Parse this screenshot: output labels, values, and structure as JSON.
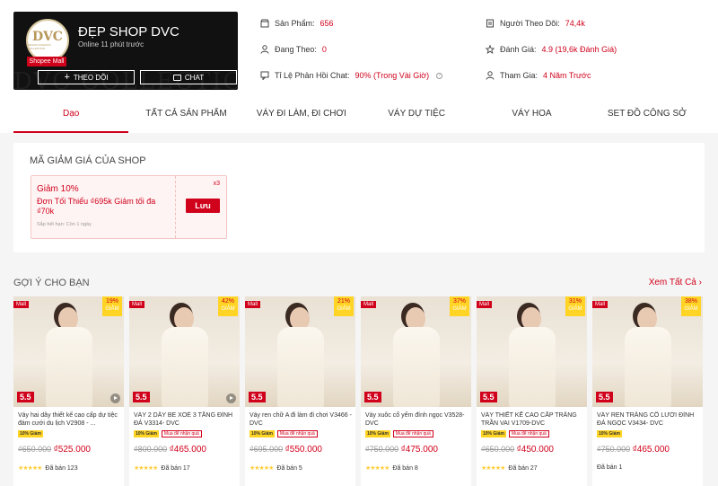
{
  "shop": {
    "name": "ĐẸP SHOP DVC",
    "online": "Online 11 phút trước",
    "mall_badge": "Shopee Mall",
    "avatar_logo": "DVC",
    "avatar_sub": "DESIGN FASHION COLLECTION",
    "bg_text": "DVC COLLECTION",
    "follow_label": "THEO DÕI",
    "chat_label": "CHAT"
  },
  "stats": {
    "products_label": "Sản Phẩm:",
    "products_value": "656",
    "following_label": "Đang Theo:",
    "following_value": "0",
    "chat_label": "Tỉ Lệ Phản Hồi Chat:",
    "chat_value": "90% (Trong Vài Giờ)",
    "followers_label": "Người Theo Dõi:",
    "followers_value": "74,4k",
    "rating_label": "Đánh Giá:",
    "rating_value": "4.9 (19,6k Đánh Giá)",
    "joined_label": "Tham Gia:",
    "joined_value": "4 Năm Trước"
  },
  "tabs": [
    {
      "label": "Dạo"
    },
    {
      "label": "TẤT CẢ SẢN PHẨM"
    },
    {
      "label": "VÁY ĐI LÀM, ĐI CHƠI"
    },
    {
      "label": "VÁY DỰ TIỆC"
    },
    {
      "label": "VÁY HOA"
    },
    {
      "label": "SET ĐỒ CÔNG SỞ"
    }
  ],
  "voucher": {
    "section_title": "MÃ GIẢM GIÁ CỦA SHOP",
    "title": "Giảm 10%",
    "desc": "Đơn Tối Thiểu ₫695k Giảm tối đa ₫70k",
    "expiry": "Sắp hết hạn: Còn 1 ngày",
    "qty": "x3",
    "button": "Lưu"
  },
  "recommend": {
    "title": "GỢI Ý CHO BẠN",
    "see_all": "Xem Tất Cả"
  },
  "common": {
    "mall": "Mall",
    "giam": "GIẢM",
    "five": "5.5",
    "tag1": "10% Giảm",
    "tag2": "Mua để nhận quà",
    "stars": "★★★★★"
  },
  "products": [
    {
      "discount": "19%",
      "name": "Váy hai dây thiết kế cao cấp dự tiệc đám cưới du lịch V2908 - ...",
      "old": "₫650.000",
      "new": "₫525.000",
      "sold": "Đã bán 123",
      "has_play": true,
      "has_tag2": false,
      "has_stars": true
    },
    {
      "discount": "42%",
      "name": "VÁY 2 DÂY BE XOÈ 3 TẦNG ĐÍNH ĐÁ V3314- DVC",
      "old": "₫800.000",
      "new": "₫465.000",
      "sold": "Đã bán 17",
      "has_play": true,
      "has_tag2": true,
      "has_stars": true
    },
    {
      "discount": "21%",
      "name": "Váy ren chữ A đi làm đi chơi V3466 - DVC",
      "old": "₫695.000",
      "new": "₫550.000",
      "sold": "Đã bán 5",
      "has_play": false,
      "has_tag2": true,
      "has_stars": true
    },
    {
      "discount": "37%",
      "name": "Váy xuôc cổ yếm đính ngọc V3528- DVC",
      "old": "₫750.000",
      "new": "₫475.000",
      "sold": "Đã bán 8",
      "has_play": false,
      "has_tag2": true,
      "has_stars": true
    },
    {
      "discount": "31%",
      "name": "VÁY THIẾT KẾ CAO CẤP TRẮNG TRẦN VAI V1709-DVC",
      "old": "₫650.000",
      "new": "₫450.000",
      "sold": "Đã bán 27",
      "has_play": false,
      "has_tag2": true,
      "has_stars": true
    },
    {
      "discount": "38%",
      "name": "VÁY REN TRẮNG CỔ LƯỚI ĐÍNH ĐÁ NGỌC V3434- DVC",
      "old": "₫750.000",
      "new": "₫465.000",
      "sold": "Đã bán 1",
      "has_play": false,
      "has_tag2": false,
      "has_stars": false
    }
  ]
}
